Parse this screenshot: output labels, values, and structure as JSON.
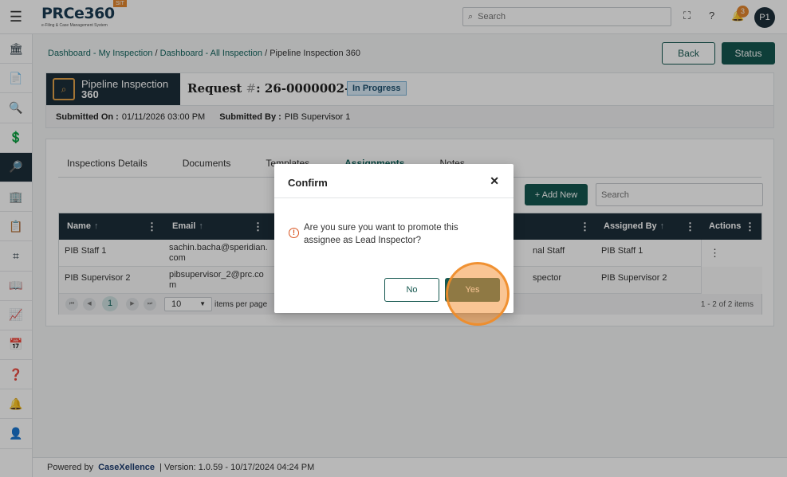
{
  "header": {
    "brand": "PRCe360",
    "brand_tag": "SIT",
    "brand_sub": "e-Filing & Case Management System",
    "search_placeholder": "Search",
    "notification_count": "3",
    "avatar_initials": "P1"
  },
  "sidebar": {
    "items": [
      {
        "icon": "bank-icon",
        "glyph": "🏛"
      },
      {
        "icon": "document-icon",
        "glyph": "📄"
      },
      {
        "icon": "document-search-icon",
        "glyph": "🔍"
      },
      {
        "icon": "document-dollar-icon",
        "glyph": "💲"
      },
      {
        "icon": "inspection-icon",
        "glyph": "🔎"
      },
      {
        "icon": "building-icon",
        "glyph": "🏢"
      },
      {
        "icon": "template-icon",
        "glyph": "📋"
      },
      {
        "icon": "scan-icon",
        "glyph": "⌗"
      },
      {
        "icon": "book-icon",
        "glyph": "📖"
      },
      {
        "icon": "chart-icon",
        "glyph": "📈"
      },
      {
        "icon": "calendar-icon",
        "glyph": "📅"
      },
      {
        "icon": "help-document-icon",
        "glyph": "❓"
      },
      {
        "icon": "alarm-icon",
        "glyph": "🔔"
      },
      {
        "icon": "user-circle-icon",
        "glyph": "👤"
      }
    ]
  },
  "breadcrumb": {
    "item1": "Dashboard - My Inspection",
    "sep": " / ",
    "item2": "Dashboard - All Inspection",
    "current": "Pipeline Inspection 360"
  },
  "actions": {
    "back": "Back",
    "status": "Status"
  },
  "request": {
    "module_line1": "Pipeline Inspection",
    "module_line2": "360",
    "title_prefix": "Request ",
    "title_hash": "#",
    "title_number": ": 26-0000002-BT",
    "status": "In Progress",
    "submitted_on_label": "Submitted On :",
    "submitted_on_value": "01/11/2026 03:00 PM",
    "submitted_by_label": "Submitted By :",
    "submitted_by_value": "PIB Supervisor 1"
  },
  "tabs": [
    "Inspections Details",
    "Documents",
    "Templates",
    "Assignments",
    "Notes"
  ],
  "active_tab": "Assignments",
  "grid": {
    "add_new": "+ Add New",
    "search_placeholder": "Search",
    "columns": {
      "name": "Name",
      "email": "Email",
      "assigned_by": "Assigned By",
      "actions": "Actions"
    },
    "rows": [
      {
        "name": "PIB Staff 1",
        "email": "sachin.bacha@speridian.com",
        "role": "nal Staff",
        "assigned_by": "PIB Staff 1"
      },
      {
        "name": "PIB Supervisor 2",
        "email": "pibsupervisor_2@prc.com",
        "role": "spector",
        "assigned_by": "PIB Supervisor 2"
      }
    ],
    "pager": {
      "current_page": "1",
      "page_size": "10",
      "items_per_page": "items per page",
      "count": "1 - 2 of 2 items"
    }
  },
  "footer": {
    "powered_by": "Powered by",
    "company": "CaseXellence",
    "version": "|  Version: 1.0.59 - 10/17/2024 04:24 PM"
  },
  "modal": {
    "title": "Confirm",
    "message": "Are you sure you want to promote this assignee as Lead Inspector?",
    "no": "No",
    "yes": "Yes"
  },
  "colors": {
    "primary": "#14574f",
    "dark_navy": "#1d2f3a",
    "accent_orange": "#e3872f",
    "warning": "#d9531e"
  }
}
